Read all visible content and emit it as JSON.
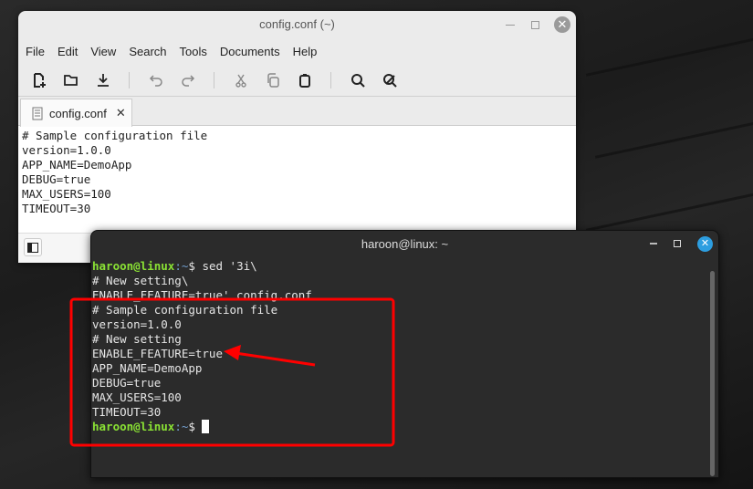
{
  "editor": {
    "title": "config.conf (~)",
    "menu": [
      "File",
      "Edit",
      "View",
      "Search",
      "Tools",
      "Documents",
      "Help"
    ],
    "tab_label": "config.conf",
    "lines": [
      "# Sample configuration file",
      "version=1.0.0",
      "APP_NAME=DemoApp",
      "DEBUG=true",
      "MAX_USERS=100",
      "TIMEOUT=30"
    ]
  },
  "terminal": {
    "title": "haroon@linux: ~",
    "prompt_user": "haroon@linux",
    "prompt_path": ":~",
    "prompt_symbol": "$ ",
    "command": "sed '3i\\",
    "command_lines": [
      "# New setting\\",
      "ENABLE_FEATURE=true' config.conf"
    ],
    "output": [
      "# Sample configuration file",
      "version=1.0.0",
      "# New setting",
      "ENABLE_FEATURE=true",
      "APP_NAME=DemoApp",
      "DEBUG=true",
      "MAX_USERS=100",
      "TIMEOUT=30"
    ]
  },
  "colors": {
    "accent_close": "#2d9ee0",
    "highlight": "#ff0000",
    "prompt": "#8ae234"
  }
}
